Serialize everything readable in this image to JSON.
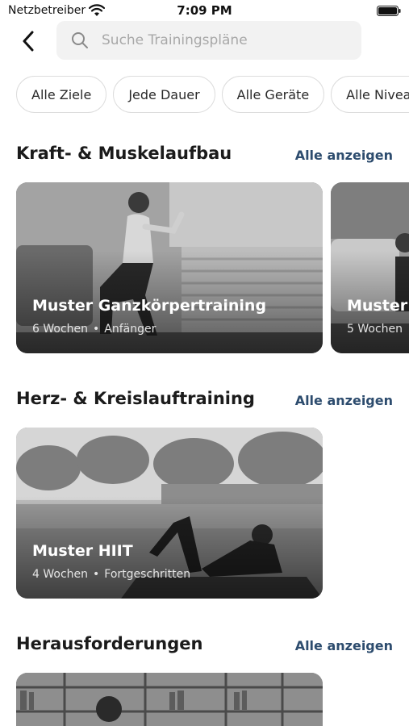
{
  "status_bar": {
    "carrier": "Netzbetreiber",
    "time": "7:09 PM"
  },
  "nav": {
    "back_icon": "chevron-left-icon",
    "search_placeholder": "Suche Trainingspläne",
    "search_icon": "search-icon"
  },
  "filters": [
    "Alle Ziele",
    "Jede Dauer",
    "Alle Geräte",
    "Alle Niveaus"
  ],
  "sections": [
    {
      "title": "Kraft- & Muskelaufbau",
      "see_all": "Alle anzeigen",
      "cards": [
        {
          "title": "Muster Ganzkörpertraining",
          "duration": "6 Wochen",
          "level": "Anfänger"
        },
        {
          "title": "Muster",
          "duration": "5 Wochen",
          "level": ""
        }
      ]
    },
    {
      "title": "Herz- & Kreislauftraining",
      "see_all": "Alle anzeigen",
      "cards": [
        {
          "title": "Muster HIIT",
          "duration": "4 Wochen",
          "level": "Fortgeschritten"
        }
      ]
    },
    {
      "title": "Herausforderungen",
      "see_all": "Alle anzeigen",
      "cards": []
    }
  ],
  "meta_separator": "•",
  "colors": {
    "link": "#2d4c6e",
    "chip_border": "#dcdcdc",
    "search_bg": "#f2f2f2"
  }
}
